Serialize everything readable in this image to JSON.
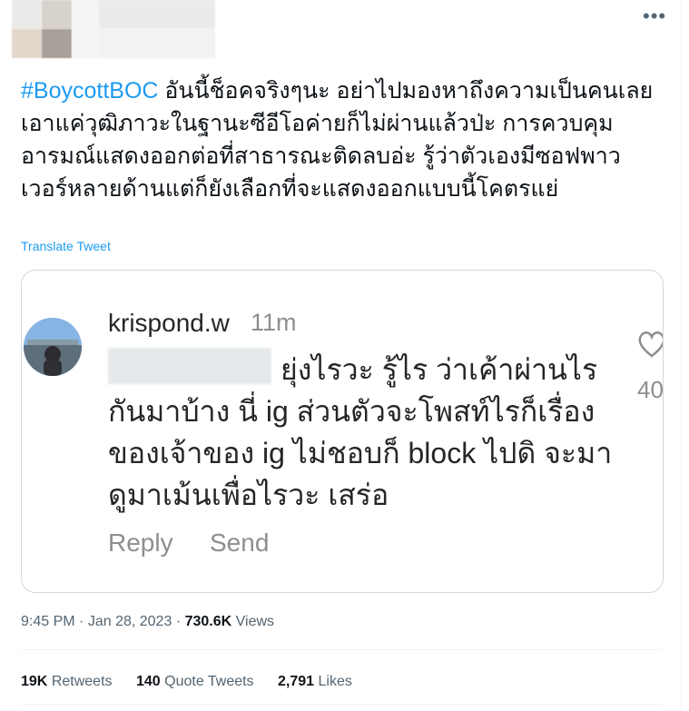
{
  "tweet": {
    "hashtag": "#BoycottBOC",
    "body": " อันนี้ช็อคจริงๆนะ อย่าไปมองหาถึงความเป็นคนเลย เอาแค่วุฒิภาวะในฐานะซีอีโอค่ายก็ไม่ผ่านแล้วป่ะ การควบคุมอารมณ์แสดงออกต่อที่สาธารณะติดลบอ่ะ รู้ว่าตัวเองมีซอฟพาวเวอร์หลายด้านแต่ก็ยังเลือกที่จะแสดงออกแบบนี้โคตรแย่",
    "translate_label": "Translate Tweet",
    "time": "9:45 PM",
    "date": "Jan 28, 2023",
    "views_count": "730.6K",
    "views_label": "Views",
    "retweets_count": "19K",
    "retweets_label": "Retweets",
    "quotes_count": "140",
    "quotes_label": "Quote Tweets",
    "likes_count": "2,791",
    "likes_label": "Likes"
  },
  "embedded": {
    "username": "krispond.w",
    "timestamp": "11m",
    "comment": "ยุ่งไรวะ รู้ไร ว่าเค้าผ่านไรกันมาบ้าง นี่ ig ส่วนตัวจะโพสท์ไรก็เรื่องของเจ้าของ ig ไม่ชอบก็ block ไปดิ จะมาดูมาเม้นเพื่อไรวะ เสร่อ",
    "reply_label": "Reply",
    "send_label": "Send",
    "like_count_partial": "40"
  },
  "icons": {
    "more": "more-icon",
    "heart": "heart-icon"
  },
  "colors": {
    "link": "#1d9bf0",
    "text": "#0f1419",
    "muted": "#536471"
  }
}
